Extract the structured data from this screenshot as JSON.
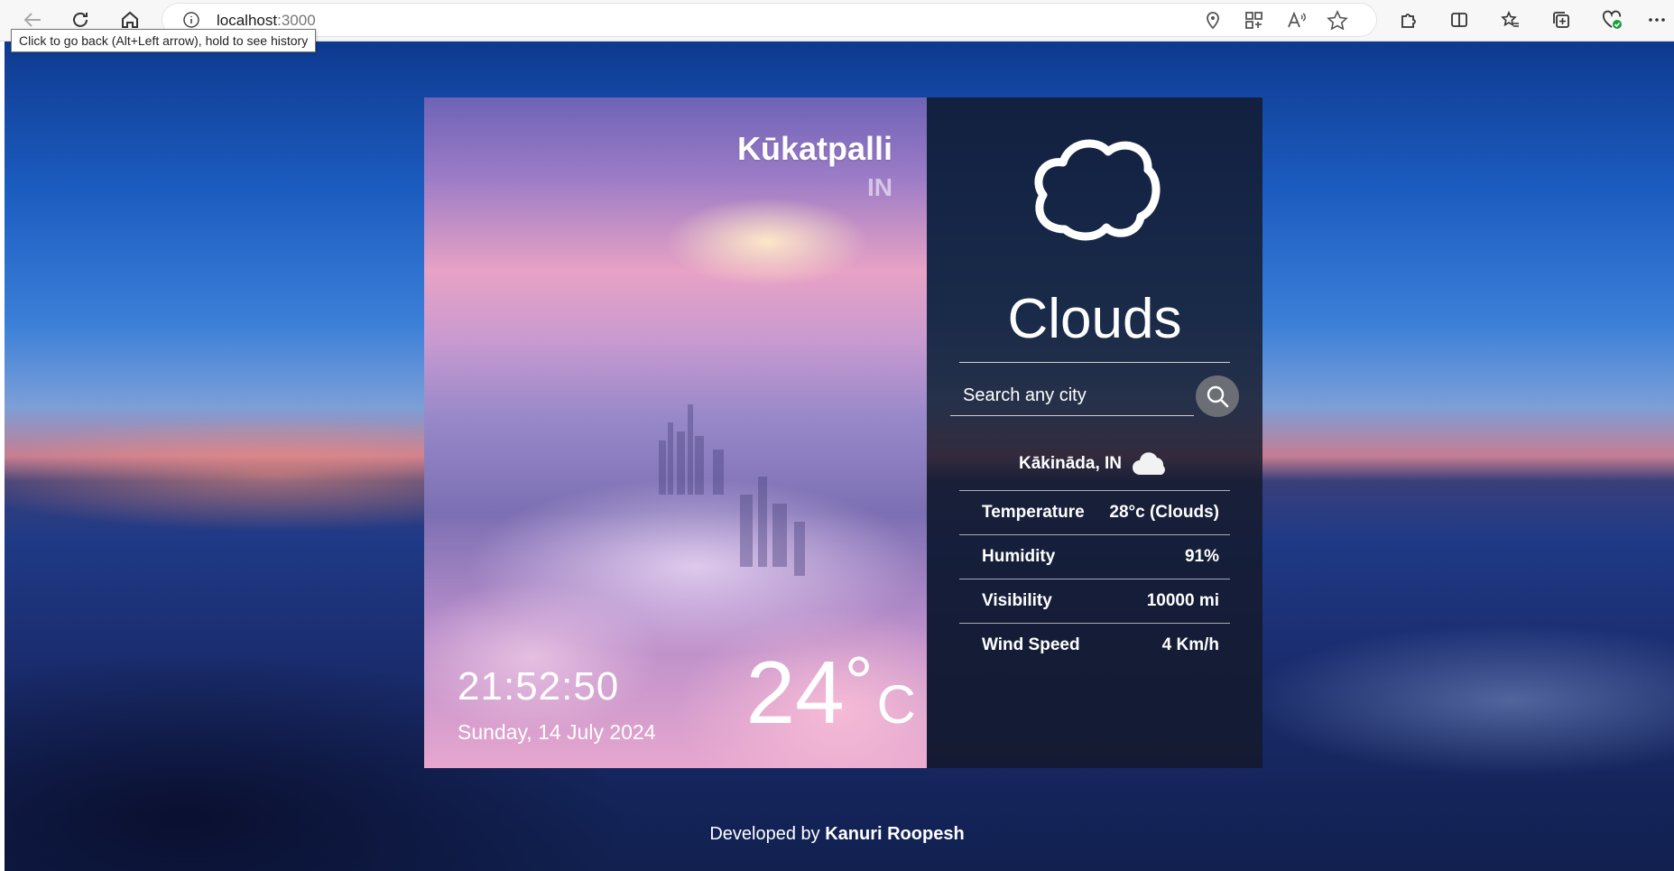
{
  "browser": {
    "url_host": "localhost",
    "url_port": ":3000",
    "tooltip": "Click to go back (Alt+Left arrow), hold to see history"
  },
  "weather": {
    "city": "Kūkatpalli",
    "country": "IN",
    "time": "21:52:50",
    "date": "Sunday, 14 July 2024",
    "temperature": "24",
    "degree_symbol": "°",
    "unit": "C",
    "condition": "Clouds"
  },
  "search": {
    "placeholder": "Search any city",
    "value": ""
  },
  "details": {
    "location": "Kākināda, IN",
    "rows": [
      {
        "label": "Temperature",
        "value": "28°c (Clouds)"
      },
      {
        "label": "Humidity",
        "value": "91%"
      },
      {
        "label": "Visibility",
        "value": "10000 mi"
      },
      {
        "label": "Wind Speed",
        "value": "4 Km/h"
      }
    ]
  },
  "footer": {
    "prefix": "Developed by ",
    "author": "Kanuri Roopesh"
  },
  "icons": {
    "back": "back-arrow-icon",
    "refresh": "refresh-icon",
    "home": "home-icon",
    "condition": "cloud-icon",
    "search": "search-icon",
    "small_cloud": "cloud-icon"
  }
}
